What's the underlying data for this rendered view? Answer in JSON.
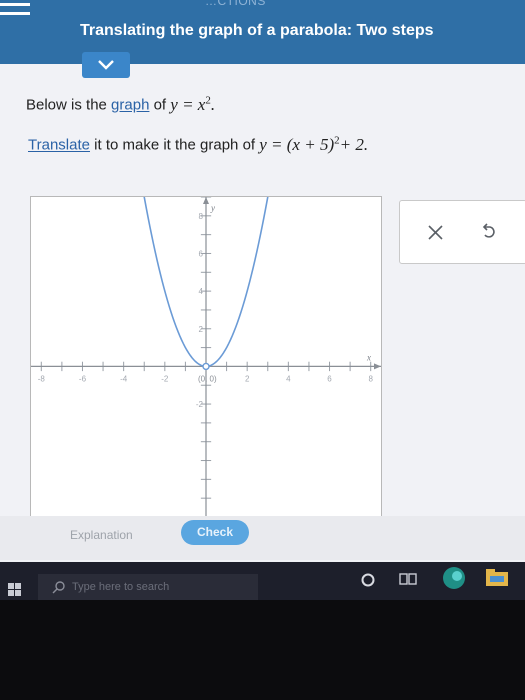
{
  "header": {
    "subtitle": "…CTIONS",
    "title": "Translating the graph of a parabola: Two steps"
  },
  "prompt": {
    "line1_prefix": "Below is the",
    "line1_link": "graph",
    "line1_mid": "of",
    "line1_math": "y = x",
    "line1_exp": "2",
    "line1_end": ".",
    "line2_link": "Translate",
    "line2_mid": "it to make it the graph of",
    "line2_math": "y = (x + 5)",
    "line2_exp": "2",
    "line2_tail": "+ 2."
  },
  "graph": {
    "x_tick_labels": [
      "-8",
      "-6",
      "-4",
      "-2",
      "2",
      "4",
      "6",
      "8"
    ],
    "y_tick_labels": [
      "8",
      "6",
      "4",
      "2",
      "-2"
    ],
    "x_axis_label": "x",
    "y_axis_label": "y",
    "vertex_label": "(0, 0)",
    "xlim": [
      -8.5,
      8.5
    ],
    "ylim": [
      -8,
      9
    ],
    "parabola": {
      "a": 1,
      "h": 0,
      "k": 0
    }
  },
  "tools": {
    "clear_icon": "close-icon",
    "undo_icon": "undo-icon"
  },
  "footer": {
    "explanation_label": "Explanation",
    "check_label": "Check"
  },
  "taskbar": {
    "search_placeholder": "Type here to search"
  },
  "colors": {
    "header": "#2f6fa6",
    "curve": "#6b9bd6",
    "check": "#5aa6e0"
  }
}
